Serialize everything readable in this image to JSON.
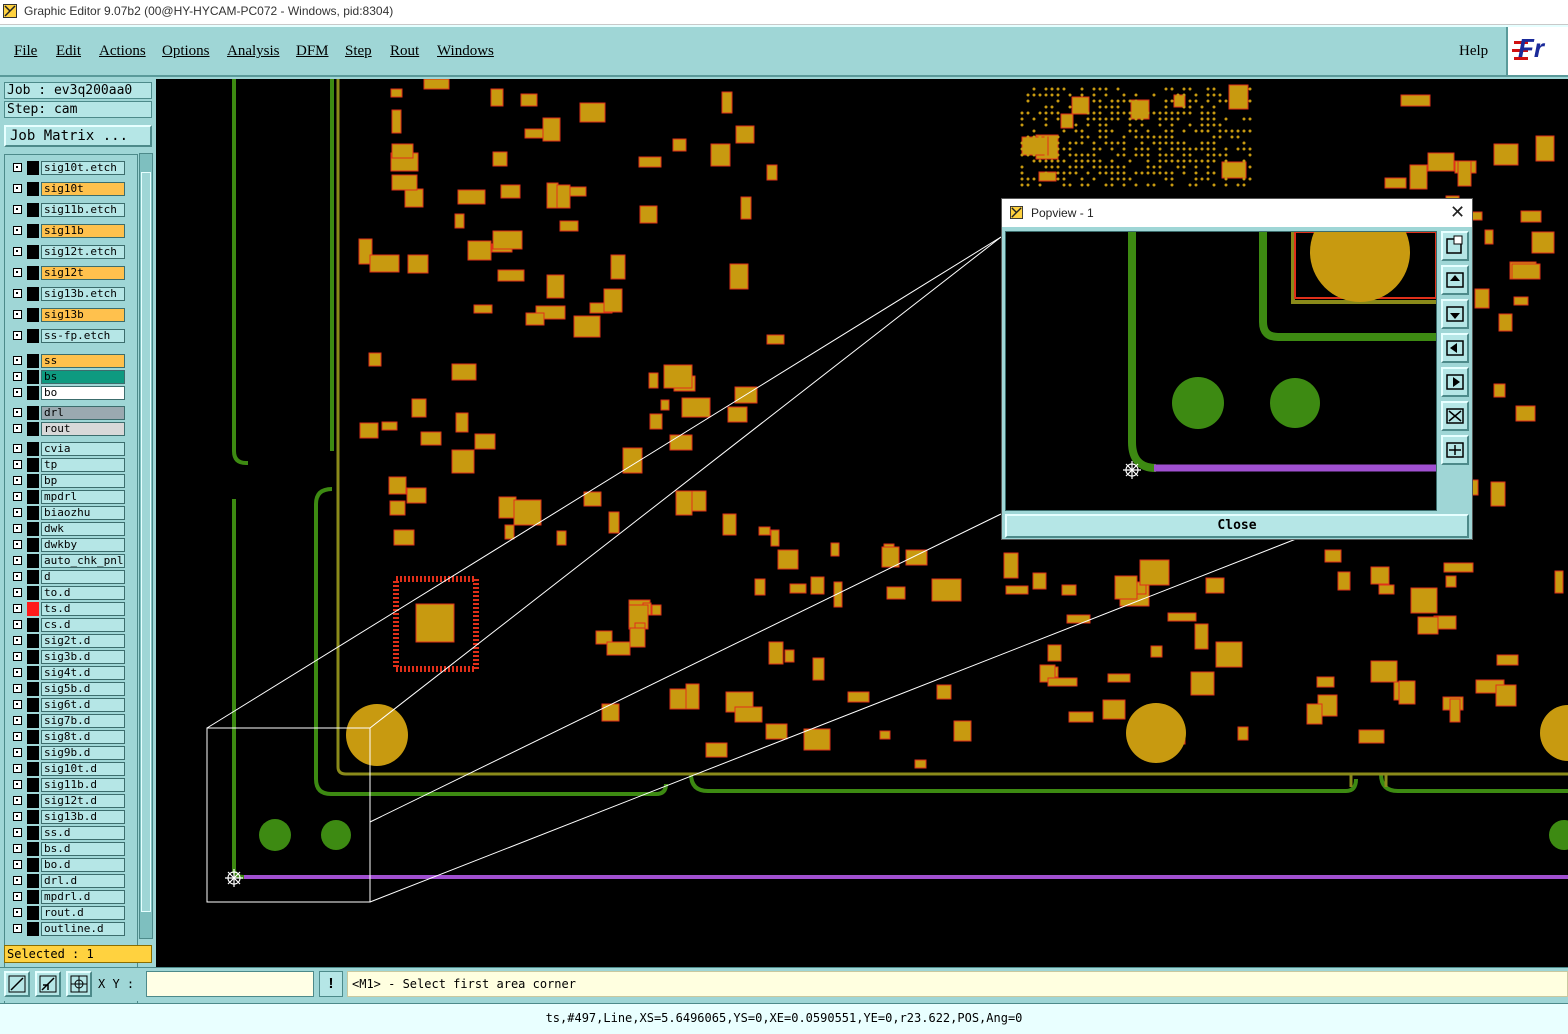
{
  "window": {
    "title": "Graphic Editor 9.07b2 (00@HY-HYCAM-PC072 - Windows, pid:8304)"
  },
  "menu": {
    "items": [
      "File",
      "Edit",
      "Actions",
      "Options",
      "Analysis",
      "DFM",
      "Step",
      "Rout",
      "Windows"
    ],
    "help": "Help",
    "logo": "Fr"
  },
  "job": {
    "label": "Job : ev3q200aa0",
    "step": "Step: cam",
    "matrix_button": "Job Matrix ..."
  },
  "layers": [
    {
      "name": "sig10t.etch",
      "color": "#b5e6e6"
    },
    {
      "name": "sig10t",
      "color": "#ffc14d"
    },
    {
      "name": "sig11b.etch",
      "color": "#b5e6e6"
    },
    {
      "name": "sig11b",
      "color": "#ffc14d"
    },
    {
      "name": "sig12t.etch",
      "color": "#b5e6e6"
    },
    {
      "name": "sig12t",
      "color": "#ffc14d"
    },
    {
      "name": "sig13b.etch",
      "color": "#b5e6e6"
    },
    {
      "name": "sig13b",
      "color": "#ffc14d"
    },
    {
      "name": "ss-fp.etch",
      "color": "#b5e6e6"
    },
    {
      "name": "ss",
      "color": "#ffc14d"
    },
    {
      "name": "bs",
      "color": "#0e9a80"
    },
    {
      "name": "bo",
      "color": "#ffffff"
    },
    {
      "name": "drl",
      "color": "#9aa9b0"
    },
    {
      "name": "rout",
      "color": "#d8d8d8"
    },
    {
      "name": "cvia",
      "color": "#b5e6e6"
    },
    {
      "name": "tp",
      "color": "#b5e6e6"
    },
    {
      "name": "bp",
      "color": "#b5e6e6"
    },
    {
      "name": "mpdrl",
      "color": "#b5e6e6"
    },
    {
      "name": "biaozhu",
      "color": "#b5e6e6"
    },
    {
      "name": "dwk",
      "color": "#b5e6e6"
    },
    {
      "name": "dwkby",
      "color": "#b5e6e6"
    },
    {
      "name": "auto_chk_pnl",
      "color": "#b5e6e6"
    },
    {
      "name": "d",
      "color": "#b5e6e6"
    },
    {
      "name": "to.d",
      "color": "#b5e6e6"
    },
    {
      "name": "ts.d",
      "color": "#b5e6e6",
      "marker": "#ff1a1a"
    },
    {
      "name": "cs.d",
      "color": "#b5e6e6"
    },
    {
      "name": "sig2t.d",
      "color": "#b5e6e6"
    },
    {
      "name": "sig3b.d",
      "color": "#b5e6e6"
    },
    {
      "name": "sig4t.d",
      "color": "#b5e6e6"
    },
    {
      "name": "sig5b.d",
      "color": "#b5e6e6"
    },
    {
      "name": "sig6t.d",
      "color": "#b5e6e6"
    },
    {
      "name": "sig7b.d",
      "color": "#b5e6e6"
    },
    {
      "name": "sig8t.d",
      "color": "#b5e6e6"
    },
    {
      "name": "sig9b.d",
      "color": "#b5e6e6"
    },
    {
      "name": "sig10t.d",
      "color": "#b5e6e6"
    },
    {
      "name": "sig11b.d",
      "color": "#b5e6e6"
    },
    {
      "name": "sig12t.d",
      "color": "#b5e6e6"
    },
    {
      "name": "sig13b.d",
      "color": "#b5e6e6"
    },
    {
      "name": "ss.d",
      "color": "#b5e6e6"
    },
    {
      "name": "bs.d",
      "color": "#b5e6e6"
    },
    {
      "name": "bo.d",
      "color": "#b5e6e6"
    },
    {
      "name": "drl.d",
      "color": "#b5e6e6"
    },
    {
      "name": "mpdrl.d",
      "color": "#b5e6e6"
    },
    {
      "name": "rout.d",
      "color": "#b5e6e6"
    },
    {
      "name": "outline.d",
      "color": "#b5e6e6"
    }
  ],
  "selected": "Selected : 1",
  "popview": {
    "title": "Popview - 1",
    "close_label": "Close"
  },
  "toolbar": {
    "xy_label": "X Y :",
    "xy_value": "",
    "exclaim": "!"
  },
  "prompt": "<M1> - Select first area corner",
  "status": "ts,#497,Line,XS=5.6496065,YS=0,XE=0.0590551,YE=0,r23.622,POS,Ang=0",
  "colors": {
    "pad": "#c89a10",
    "pad_stroke": "#e0301a",
    "trace_green": "#3d8a12",
    "trace_olive": "#8a8a1a",
    "trace_purple": "#a050d0",
    "background": "#000000"
  }
}
